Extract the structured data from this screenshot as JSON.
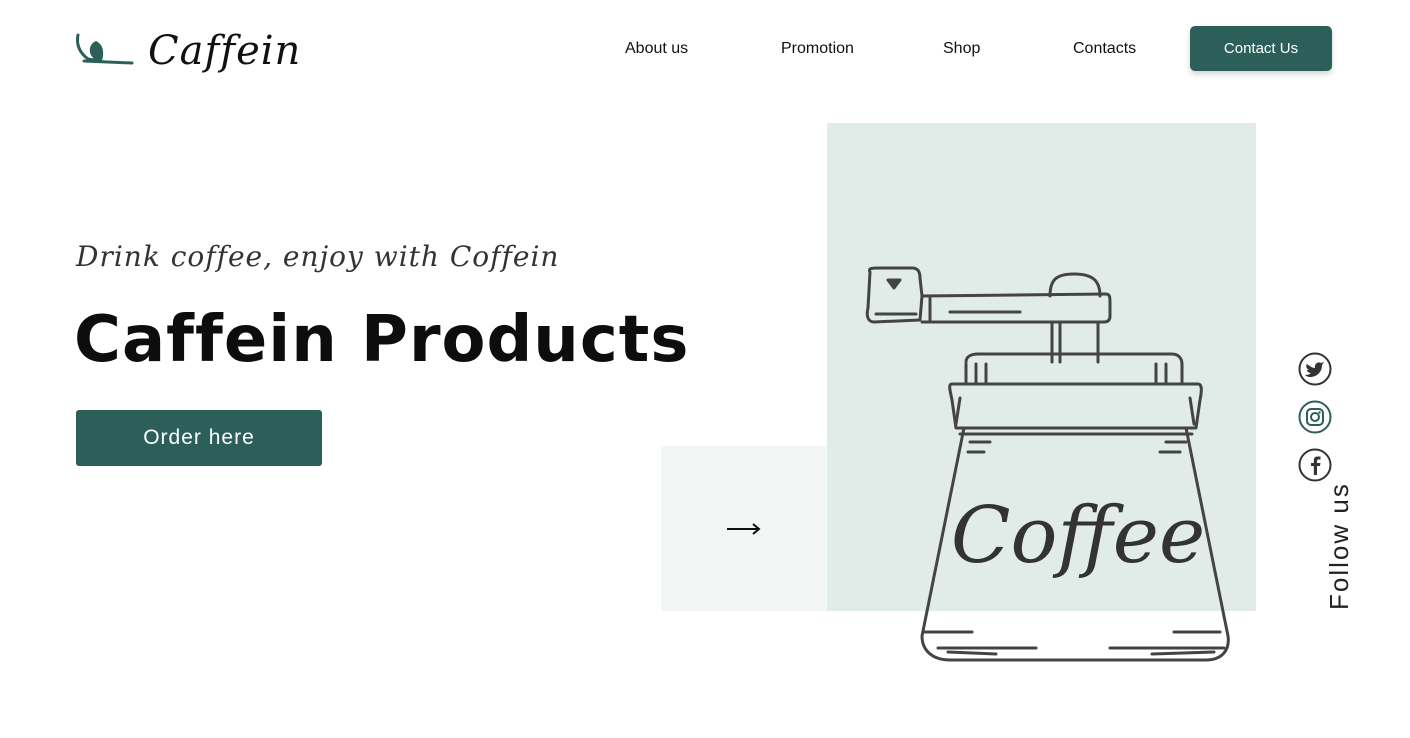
{
  "brand": {
    "name": "Caffein",
    "accent_color": "#2c5f5a",
    "logo_icon": "coffee-bean-leaf-icon"
  },
  "nav": {
    "items": [
      {
        "label": "About us"
      },
      {
        "label": "Promotion"
      },
      {
        "label": "Shop"
      },
      {
        "label": "Contacts"
      }
    ],
    "cta_label": "Contact Us"
  },
  "hero": {
    "tagline": "Drink coffee, enjoy with Coffein",
    "title": "Caffein Products",
    "order_label": "Order here",
    "next_icon": "arrow-right-icon",
    "illustration_text": "Coffee",
    "panel_color": "#e1ebe7",
    "panel_light_color": "#f2f6f4"
  },
  "social": {
    "follow_label": "Follow us",
    "icons": [
      "twitter-icon",
      "instagram-icon",
      "facebook-icon"
    ]
  }
}
